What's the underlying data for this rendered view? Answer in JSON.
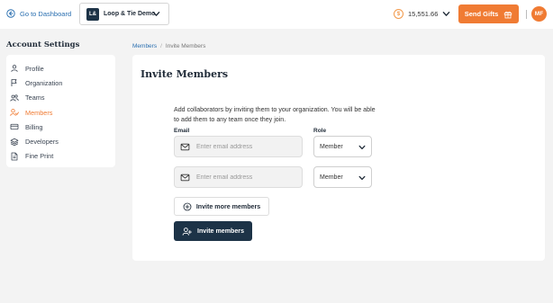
{
  "header": {
    "back_label": "Go to Dashboard",
    "org_initials": "L&",
    "org_name": "Loop & Tie Demo",
    "balance": "15,551.66",
    "send_gifts_label": "Send Gifts",
    "avatar_initials": "MF",
    "accent_color": "#f07b33",
    "dark_color": "#1d3347"
  },
  "sidebar": {
    "title": "Account Settings",
    "items": [
      {
        "label": "Profile",
        "icon": "user-icon"
      },
      {
        "label": "Organization",
        "icon": "flag-icon"
      },
      {
        "label": "Teams",
        "icon": "users-icon"
      },
      {
        "label": "Members",
        "icon": "members-icon",
        "active": true
      },
      {
        "label": "Billing",
        "icon": "credit-card-icon"
      },
      {
        "label": "Developers",
        "icon": "layers-icon"
      },
      {
        "label": "Fine Print",
        "icon": "file-icon"
      }
    ]
  },
  "breadcrumb": {
    "parent": "Members",
    "separator": "/",
    "current": "Invite Members"
  },
  "main": {
    "title": "Invite Members",
    "description": "Add collaborators by inviting them to your organization. You will be able to add them to any team once they join.",
    "email_label": "Email",
    "role_label": "Role",
    "rows": [
      {
        "email_placeholder": "Enter email address",
        "email_value": "",
        "role": "Member"
      },
      {
        "email_placeholder": "Enter email address",
        "email_value": "",
        "role": "Member"
      }
    ],
    "invite_more_label": "Invite more members",
    "invite_label": "Invite members"
  }
}
